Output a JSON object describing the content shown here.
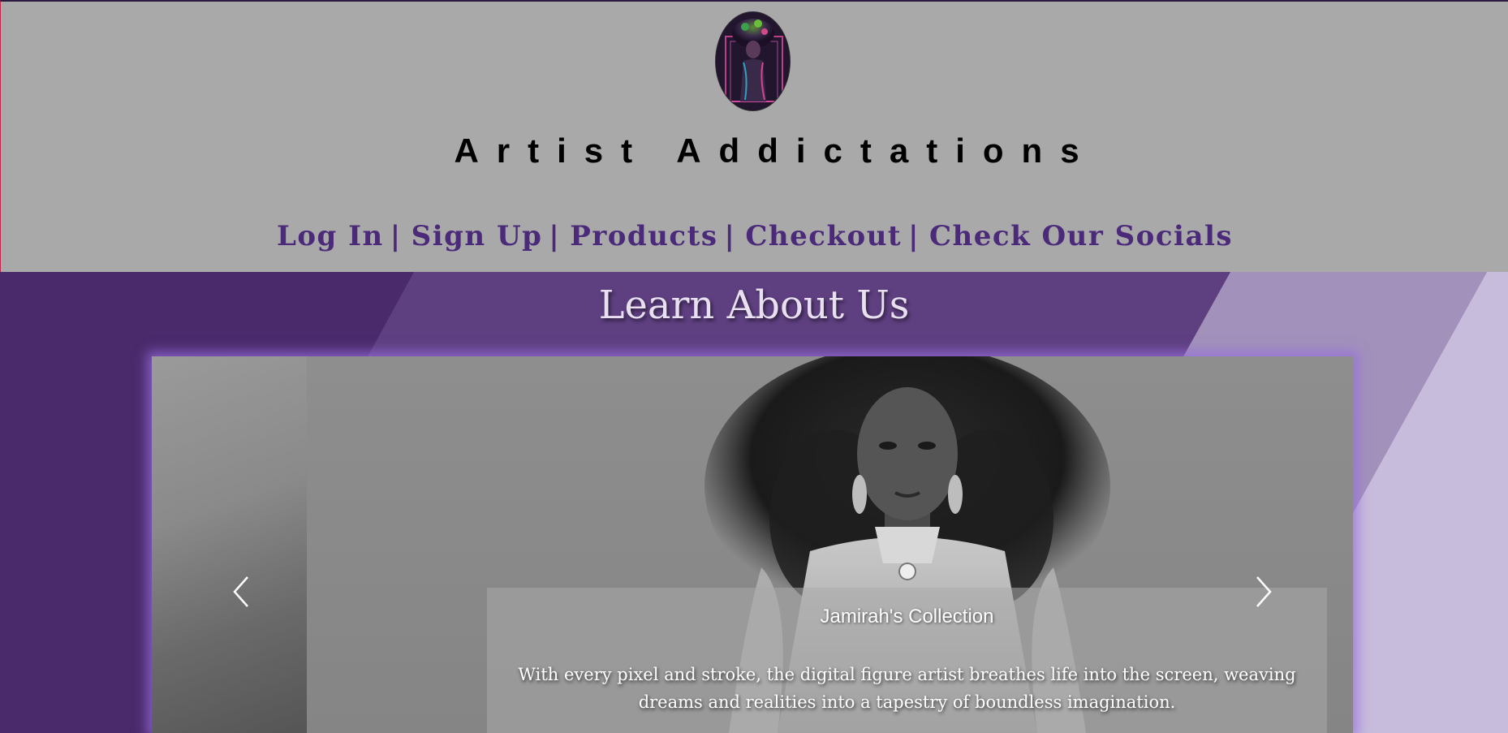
{
  "header": {
    "site_title": "Artist Addictations"
  },
  "nav": {
    "items": [
      {
        "label": "Log In"
      },
      {
        "label": "Sign Up"
      },
      {
        "label": "Products"
      },
      {
        "label": "Checkout"
      },
      {
        "label": "Check Our Socials"
      }
    ],
    "separator": "|"
  },
  "main": {
    "section_title": "Learn About Us",
    "carousel": {
      "slide": {
        "caption_title": "Jamirah's Collection",
        "caption_text": "With every pixel and stroke, the digital figure artist breathes life into the screen, weaving dreams and realities into a tapestry of boundless imagination."
      },
      "prev_icon": "chevron-left-icon",
      "next_icon": "chevron-right-icon"
    }
  },
  "colors": {
    "header_bg": "#a9a9a9",
    "nav_text": "#4b2a7a",
    "band_dark": "#4a2a6b",
    "band_mid": "#5e3f80",
    "band_light": "#a291bb",
    "band_lightest": "#c8bcdc",
    "carousel_glow": "#966edc"
  }
}
